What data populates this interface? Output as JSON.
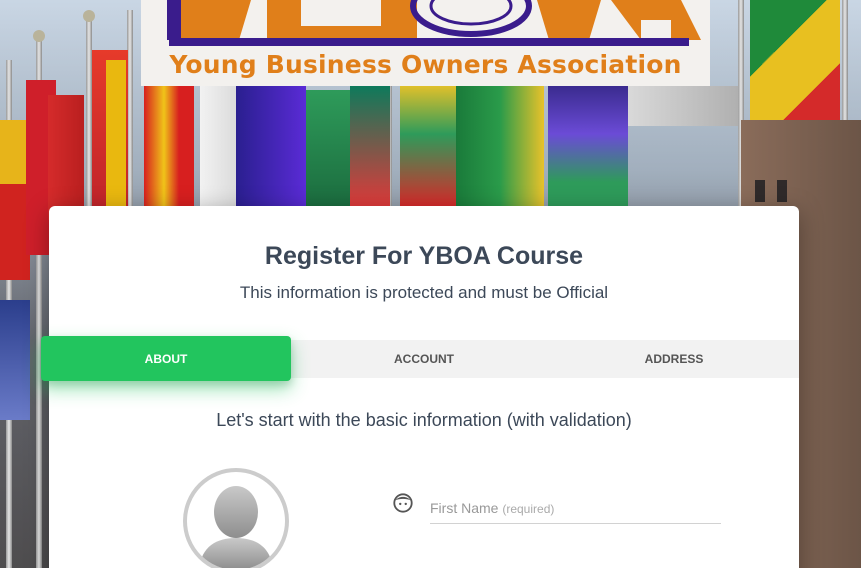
{
  "logo": {
    "title": "Young Business Owners Association",
    "brand_colors": {
      "orange": "#e07f1a",
      "purple": "#3a1c8c"
    }
  },
  "card": {
    "title": "Register For YBOA Course",
    "subtitle": "This information is protected and must be Official"
  },
  "tabs": [
    {
      "label": "ABOUT",
      "active": true
    },
    {
      "label": "ACCOUNT",
      "active": false
    },
    {
      "label": "ADDRESS",
      "active": false
    }
  ],
  "step": {
    "heading": "Let's start with the basic information (with validation)"
  },
  "form": {
    "first_name": {
      "label": "First Name",
      "hint": "(required)",
      "value": ""
    }
  },
  "colors": {
    "accent": "#22c55e",
    "text": "#3c4858"
  },
  "icons": {
    "avatar": "avatar-placeholder-icon",
    "face": "face-icon"
  }
}
